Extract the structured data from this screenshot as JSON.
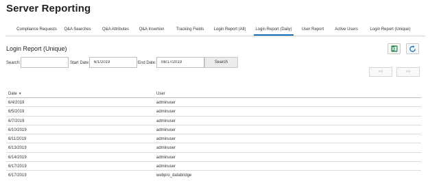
{
  "app_title": "Server Reporting",
  "tabs": [
    {
      "label": "Compliance Requests"
    },
    {
      "label": "Q&A Searches"
    },
    {
      "label": "Q&A Attributes"
    },
    {
      "label": "Q&A Insertion"
    },
    {
      "label": "Tracking Fields"
    },
    {
      "label": "Login Report (All)"
    },
    {
      "label": "Login Report (Daily)",
      "active": true
    },
    {
      "label": "User Report"
    },
    {
      "label": "Active Users"
    },
    {
      "label": "Login Report (Unique)"
    }
  ],
  "section_title": "Login Report (Unique)",
  "toolbar": {
    "excel_icon": "excel-export-icon",
    "refresh_icon": "refresh-icon",
    "accent_green": "#1e7e45",
    "accent_blue": "#1a73b8"
  },
  "filters": {
    "search_label": "Search:",
    "search_value": "",
    "start_label": "Start Date:",
    "start_value": "6/1/2019",
    "end_label": "End Date:",
    "end_value": "06/17/2019",
    "search_button": "Search"
  },
  "pager": {
    "prev_label": "<<",
    "next_label": ">>"
  },
  "table": {
    "columns": {
      "date": "Date",
      "user": "User"
    },
    "sort_icon": "sort-desc-icon",
    "rows": [
      {
        "date": "6/4/2019",
        "user": "adminuser"
      },
      {
        "date": "6/5/2019",
        "user": "adminuser"
      },
      {
        "date": "6/7/2019",
        "user": "adminuser"
      },
      {
        "date": "6/10/2019",
        "user": "adminuser"
      },
      {
        "date": "6/11/2019",
        "user": "adminuser"
      },
      {
        "date": "6/13/2019",
        "user": "adminuser"
      },
      {
        "date": "6/14/2019",
        "user": "adminuser"
      },
      {
        "date": "6/17/2019",
        "user": "adminuser"
      },
      {
        "date": "6/17/2019",
        "user": "webpro_databridge"
      }
    ]
  }
}
